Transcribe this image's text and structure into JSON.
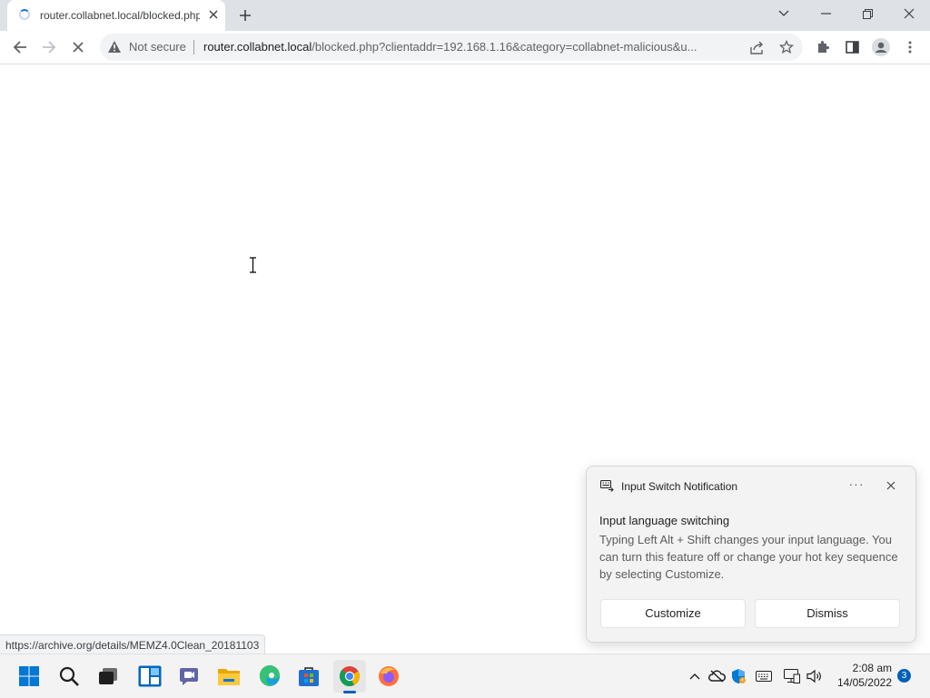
{
  "browser": {
    "tab": {
      "title": "router.collabnet.local/blocked.php",
      "close_icon": "close-icon",
      "loading": true
    },
    "new_tab_icon": "plus-icon",
    "window_controls": [
      "chevron-down-icon",
      "minimize-icon",
      "restore-icon",
      "close-icon"
    ],
    "toolbar": {
      "security_label": "Not secure",
      "url_host": "router.collabnet.local",
      "url_rest": "/blocked.php?clientaddr=192.168.1.16&category=collabnet-malicious&u...",
      "icons": [
        "back-icon",
        "forward-icon",
        "stop-icon",
        "warning-icon",
        "share-icon",
        "star-icon",
        "extensions-icon",
        "side-panel-icon",
        "profile-icon",
        "menu-icon"
      ]
    },
    "status_bar_url": "https://archive.org/details/MEMZ4.0Clean_20181103"
  },
  "notification": {
    "app_name": "Input Switch Notification",
    "more_label": "···",
    "heading": "Input language switching",
    "body": "Typing Left Alt + Shift changes your input language. You can turn this feature off or change your hot key sequence by selecting Customize.",
    "buttons": {
      "customize": "Customize",
      "dismiss": "Dismiss"
    }
  },
  "taskbar": {
    "apps": [
      "start-icon",
      "search-icon",
      "task-view-icon",
      "widgets-icon",
      "teams-chat-icon",
      "file-explorer-icon",
      "edge-icon",
      "store-icon",
      "chrome-icon",
      "firefox-icon"
    ],
    "active_app": "chrome-icon",
    "tray": [
      "chevron-up-icon",
      "onedrive-icon",
      "defender-icon",
      "keyboard-icon",
      "network-icon",
      "volume-icon"
    ],
    "time": "2:08 am",
    "date": "14/05/2022",
    "notification_count": "3"
  },
  "colors": {
    "accent": "#005fb8",
    "chrome_accent": "#1a73e8",
    "tab_strip": "#dee1e6",
    "omnibox": "#f1f3f4"
  }
}
